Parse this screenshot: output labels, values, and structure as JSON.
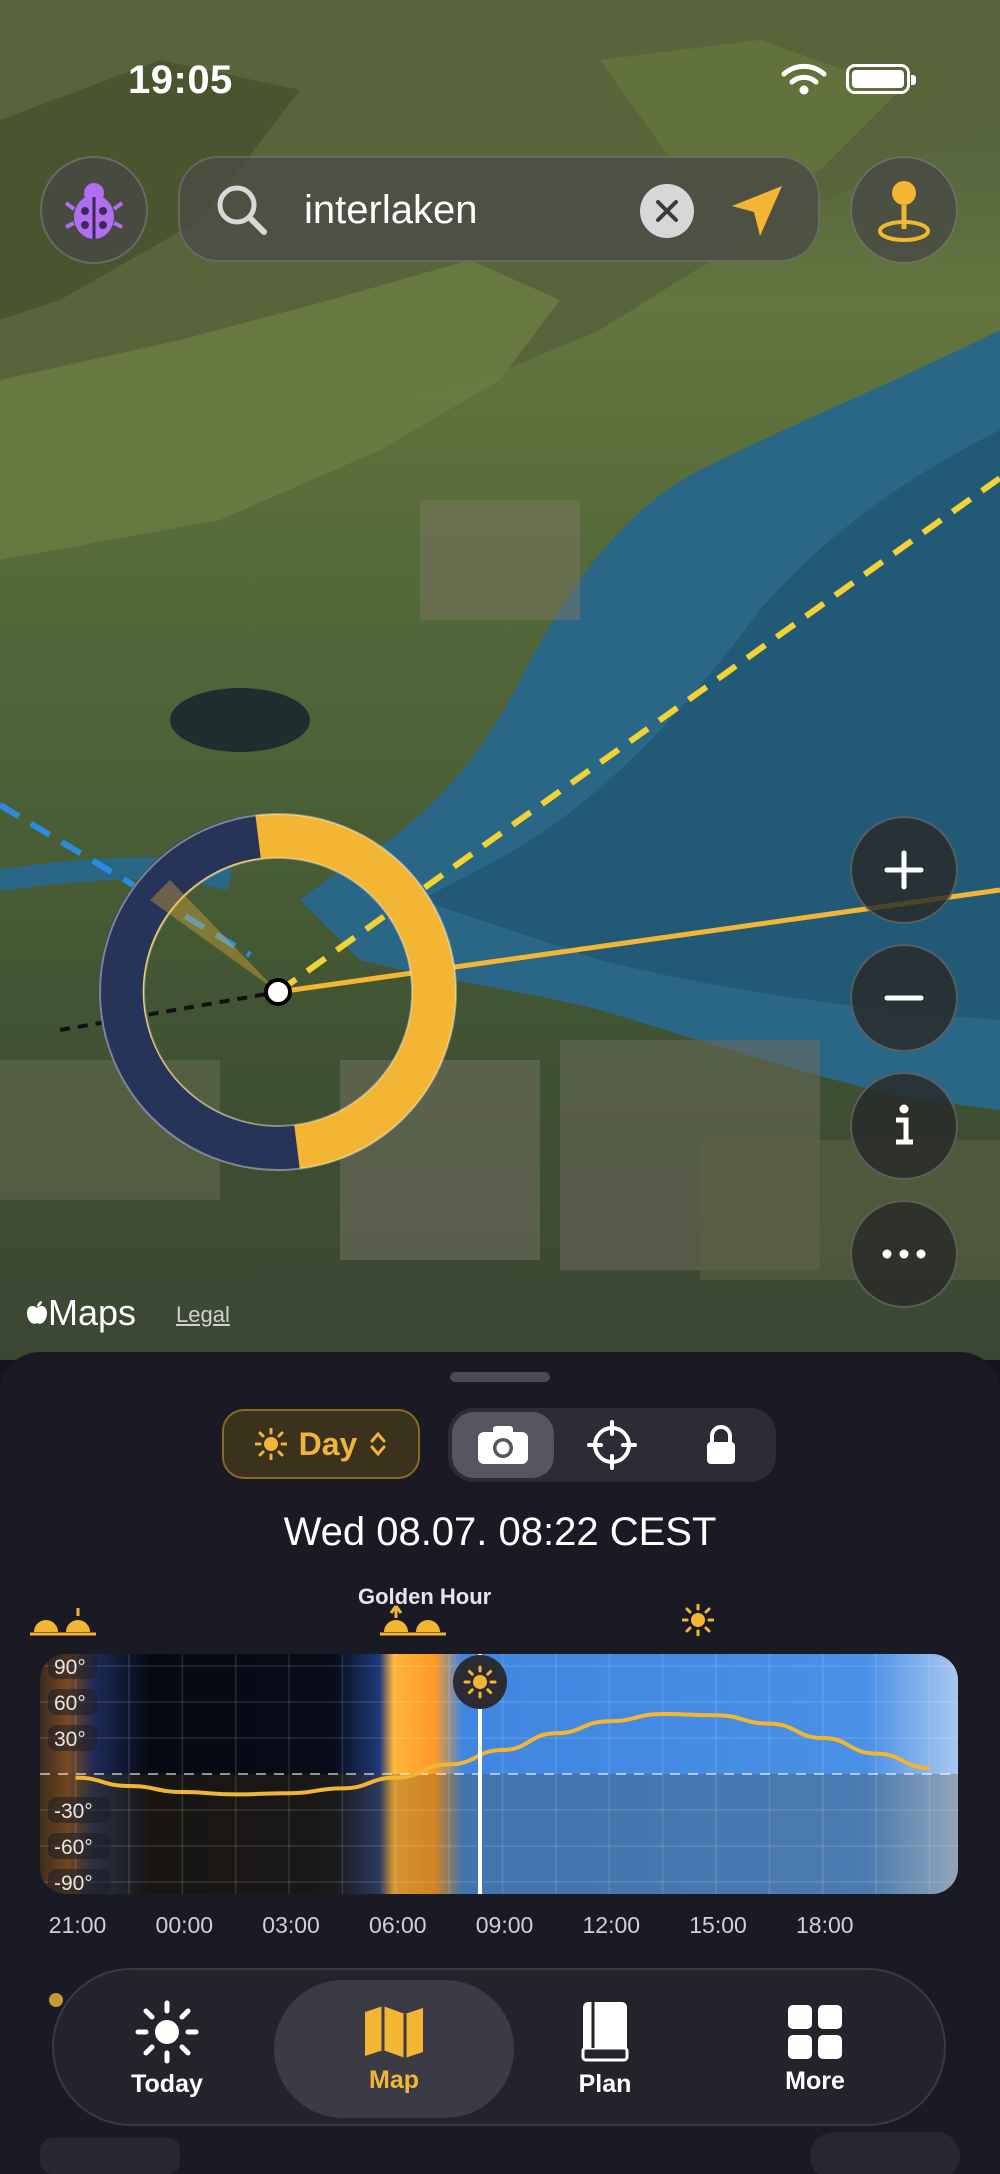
{
  "status_bar": {
    "time": "19:05"
  },
  "search": {
    "query": "interlaken"
  },
  "map": {
    "attribution": "Maps",
    "legal": "Legal"
  },
  "map_controls": {
    "zoom_in": "+",
    "zoom_out": "−",
    "info": "i",
    "more": "•••"
  },
  "sheet": {
    "mode_label": "Day",
    "datetime": "Wed 08.07. 08:22  CEST",
    "golden_hour_label": "Golden Hour",
    "y_ticks": [
      "90°",
      "60°",
      "30°",
      "-30°",
      "-60°",
      "-90°"
    ],
    "hours": [
      "21:00",
      "00:00",
      "03:00",
      "06:00",
      "09:00",
      "12:00",
      "15:00",
      "18:00"
    ]
  },
  "tabbar": {
    "tabs": [
      {
        "label": "Today",
        "icon": "sun-icon"
      },
      {
        "label": "Map",
        "icon": "map-icon"
      },
      {
        "label": "Plan",
        "icon": "book-icon"
      },
      {
        "label": "More",
        "icon": "grid-icon"
      }
    ],
    "active": "Map"
  },
  "colors": {
    "accent": "#f3b634",
    "night": "#263459",
    "sheet_bg": "#191a24",
    "sky": "#4a8fe0"
  },
  "chart_data": {
    "type": "line",
    "title": "",
    "xlabel": "",
    "ylabel": "",
    "x": [
      21,
      22.5,
      24,
      25.5,
      27,
      28.5,
      30,
      31.5,
      33,
      34.5,
      36,
      37.5,
      39,
      40.5,
      42,
      43.5,
      45
    ],
    "series": [
      {
        "values": [
          -3,
          -10,
          -15,
          -17,
          -16,
          -12,
          -3,
          8,
          20,
          34,
          44,
          50,
          49,
          42,
          30,
          17,
          5
        ]
      }
    ],
    "x_ticks": [
      "21:00",
      "00:00",
      "03:00",
      "06:00",
      "09:00",
      "12:00",
      "15:00",
      "18:00"
    ],
    "ylim": [
      -90,
      90
    ],
    "current_time": "08:22"
  }
}
